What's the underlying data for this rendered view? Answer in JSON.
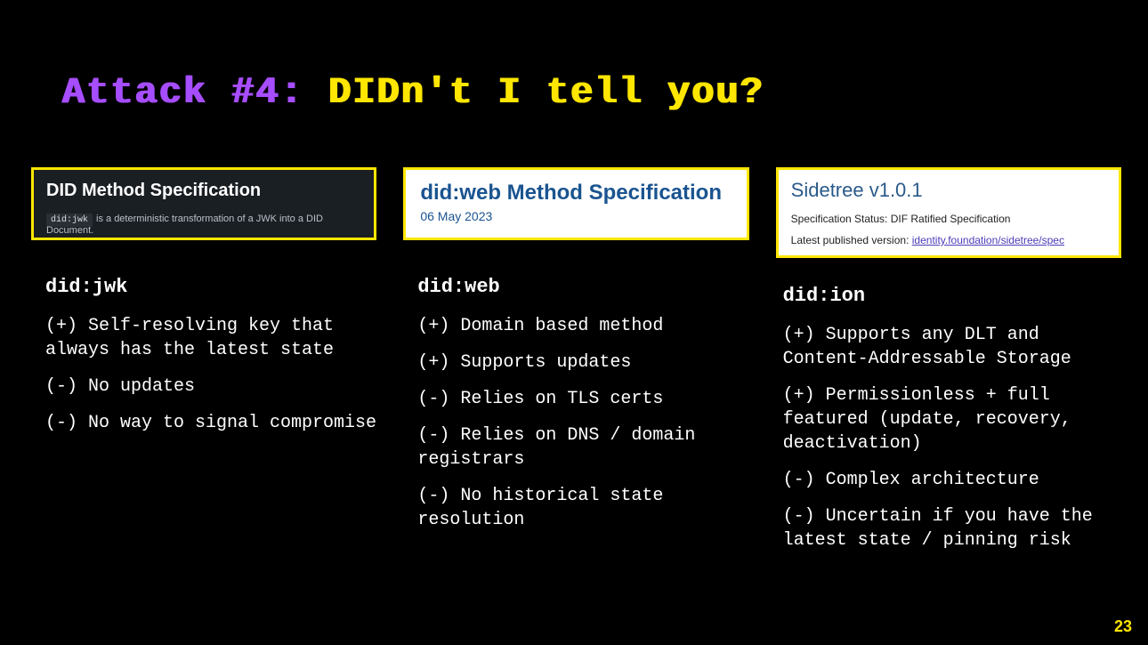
{
  "title": {
    "prefix": "Attack #4:",
    "rest": " DIDn't I tell you?"
  },
  "columns": [
    {
      "card": {
        "style": "dark",
        "title": "DID Method Specification",
        "chip": "did:jwk",
        "sub": "is a deterministic transformation of a JWK into a DID Document."
      },
      "method": "did:jwk",
      "bullets": [
        "(+) Self-resolving key that always has the latest state",
        "(-) No updates",
        "(-) No way to signal compromise"
      ]
    },
    {
      "card": {
        "style": "white",
        "title": "did:web Method Specification",
        "date": "06 May 2023"
      },
      "method": "did:web",
      "bullets": [
        "(+) Domain based method",
        "(+) Supports updates",
        "(-) Relies on TLS certs",
        "(-) Relies on DNS / domain registrars",
        "(-) No historical state resolution"
      ]
    },
    {
      "card": {
        "style": "sidetree",
        "title": "Sidetree v1.0.1",
        "status": "Specification Status: DIF Ratified Specification",
        "latest_label": "Latest published version: ",
        "latest_link": "identity.foundation/sidetree/spec"
      },
      "method": "did:ion",
      "bullets": [
        "(+) Supports any DLT and Content-Addressable Storage",
        "(+) Permissionless + full featured (update, recovery, deactivation)",
        "(-) Complex architecture",
        "(-) Uncertain if you have the latest state / pinning risk"
      ]
    }
  ],
  "page_number": "23"
}
